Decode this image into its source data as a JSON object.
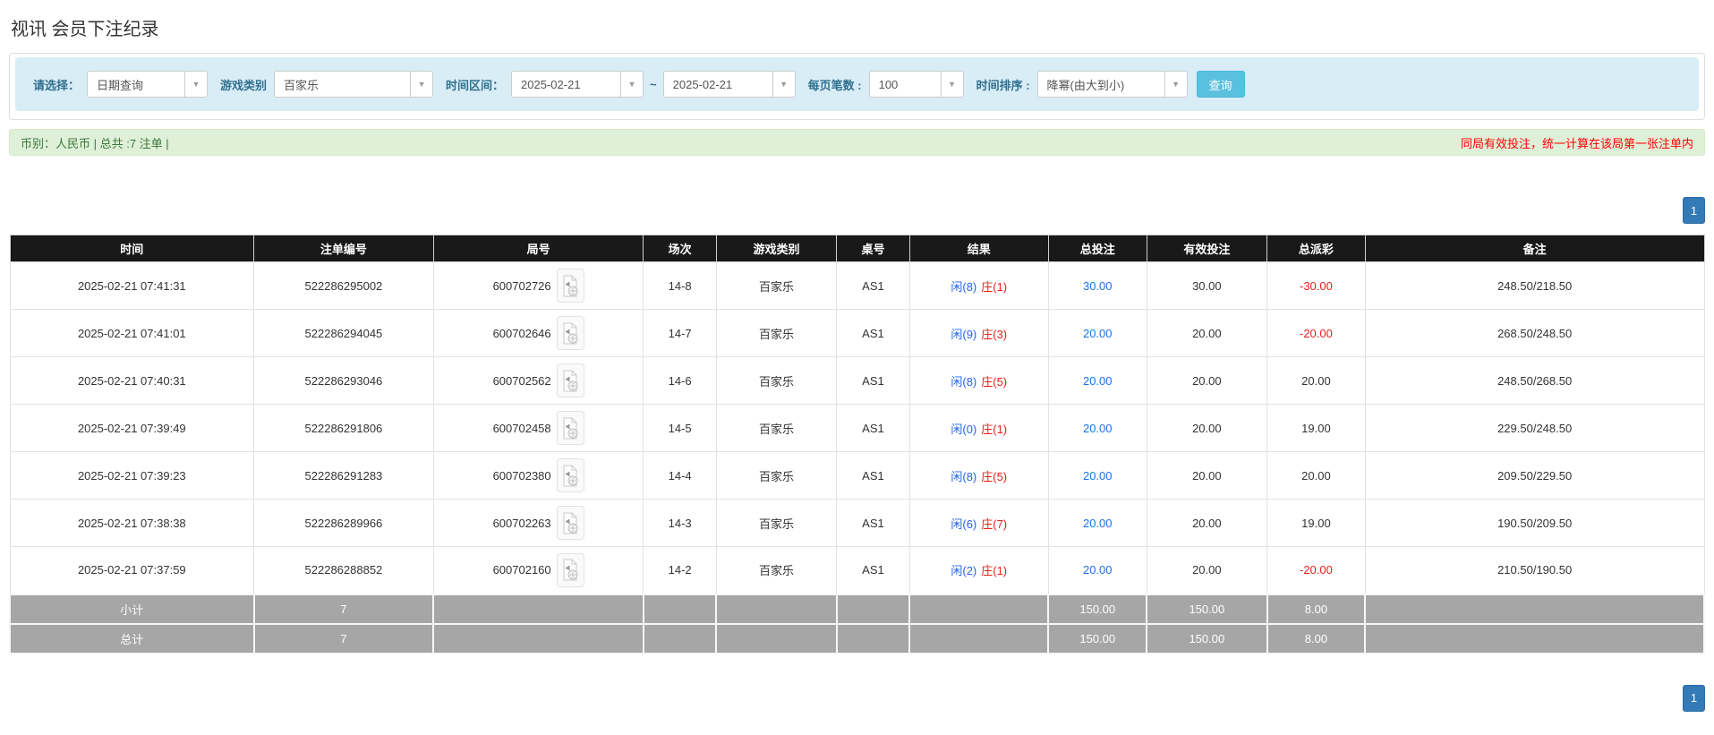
{
  "page_title": "视讯 会员下注纪录",
  "filters": {
    "mode_label": "请选择：",
    "mode_value": "日期查询",
    "game_label": "游戏类别",
    "game_value": "百家乐",
    "range_label": "时间区间：",
    "date_from": "2025-02-21",
    "tilde": "~",
    "date_to": "2025-02-21",
    "page_size_label": "每页笔数 :",
    "page_size_value": "100",
    "sort_label": "时间排序 :",
    "sort_value": "降幂(由大到小)",
    "search_button": "查询",
    "caret": "▼"
  },
  "summary": {
    "left": "币别：人民币 | 总共 :7 注单 |",
    "right": "同局有效投注，统一计算在该局第一张注单内"
  },
  "pagination": {
    "page": "1"
  },
  "colors": {
    "toolbar_bg": "#d9edf7",
    "label_blue": "#31708f",
    "search_button": "#5bc0de",
    "summary_bg": "#dff0d8",
    "summary_text": "#3c763d",
    "warning_red": "#ff0000",
    "pager_blue": "#337ab7",
    "header_black": "#191919",
    "subtotal_gray": "#a6a6a6",
    "bet_blue": "#1a73e8",
    "player_blue": "#2563eb",
    "banker_red": "#ef1c1c"
  },
  "table": {
    "headers": [
      "时间",
      "注单编号",
      "局号",
      "场次",
      "游戏类别",
      "桌号",
      "结果",
      "总投注",
      "有效投注",
      "总派彩",
      "备注"
    ],
    "rows": [
      {
        "time": "2025-02-21 07:41:31",
        "bet_id": "522286295002",
        "round_id": "600702726",
        "session": "14-8",
        "game": "百家乐",
        "table_no": "AS1",
        "result_player": "闲(8)",
        "result_banker": "庄(1)",
        "total_bet": "30.00",
        "valid_bet": "30.00",
        "payout": "-30.00",
        "note": "248.50/218.50"
      },
      {
        "time": "2025-02-21 07:41:01",
        "bet_id": "522286294045",
        "round_id": "600702646",
        "session": "14-7",
        "game": "百家乐",
        "table_no": "AS1",
        "result_player": "闲(9)",
        "result_banker": "庄(3)",
        "total_bet": "20.00",
        "valid_bet": "20.00",
        "payout": "-20.00",
        "note": "268.50/248.50"
      },
      {
        "time": "2025-02-21 07:40:31",
        "bet_id": "522286293046",
        "round_id": "600702562",
        "session": "14-6",
        "game": "百家乐",
        "table_no": "AS1",
        "result_player": "闲(8)",
        "result_banker": "庄(5)",
        "total_bet": "20.00",
        "valid_bet": "20.00",
        "payout": "20.00",
        "note": "248.50/268.50"
      },
      {
        "time": "2025-02-21 07:39:49",
        "bet_id": "522286291806",
        "round_id": "600702458",
        "session": "14-5",
        "game": "百家乐",
        "table_no": "AS1",
        "result_player": "闲(0)",
        "result_banker": "庄(1)",
        "total_bet": "20.00",
        "valid_bet": "20.00",
        "payout": "19.00",
        "note": "229.50/248.50"
      },
      {
        "time": "2025-02-21 07:39:23",
        "bet_id": "522286291283",
        "round_id": "600702380",
        "session": "14-4",
        "game": "百家乐",
        "table_no": "AS1",
        "result_player": "闲(8)",
        "result_banker": "庄(5)",
        "total_bet": "20.00",
        "valid_bet": "20.00",
        "payout": "20.00",
        "note": "209.50/229.50"
      },
      {
        "time": "2025-02-21 07:38:38",
        "bet_id": "522286289966",
        "round_id": "600702263",
        "session": "14-3",
        "game": "百家乐",
        "table_no": "AS1",
        "result_player": "闲(6)",
        "result_banker": "庄(7)",
        "total_bet": "20.00",
        "valid_bet": "20.00",
        "payout": "19.00",
        "note": "190.50/209.50"
      },
      {
        "time": "2025-02-21 07:37:59",
        "bet_id": "522286288852",
        "round_id": "600702160",
        "session": "14-2",
        "game": "百家乐",
        "table_no": "AS1",
        "result_player": "闲(2)",
        "result_banker": "庄(1)",
        "total_bet": "20.00",
        "valid_bet": "20.00",
        "payout": "-20.00",
        "note": "210.50/190.50"
      }
    ],
    "subtotal": {
      "label": "小计",
      "count": "7",
      "total_bet": "150.00",
      "valid_bet": "150.00",
      "payout": "8.00"
    },
    "total": {
      "label": "总计",
      "count": "7",
      "total_bet": "150.00",
      "valid_bet": "150.00",
      "payout": "8.00"
    }
  }
}
